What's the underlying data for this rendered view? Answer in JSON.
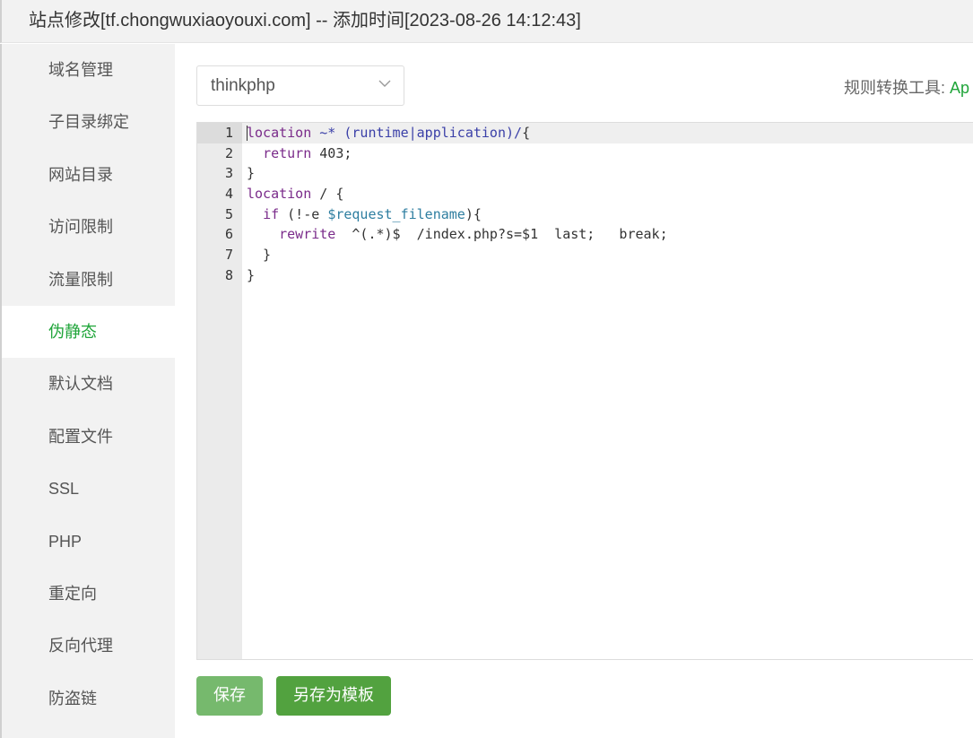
{
  "window": {
    "title": "站点修改[tf.chongwuxiaoyouxi.com] -- 添加时间[2023-08-26 14:12:43]"
  },
  "sidebar": {
    "items": [
      {
        "label": "域名管理"
      },
      {
        "label": "子目录绑定"
      },
      {
        "label": "网站目录"
      },
      {
        "label": "访问限制"
      },
      {
        "label": "流量限制"
      },
      {
        "label": "伪静态",
        "active": true
      },
      {
        "label": "默认文档"
      },
      {
        "label": "配置文件"
      },
      {
        "label": "SSL"
      },
      {
        "label": "PHP"
      },
      {
        "label": "重定向"
      },
      {
        "label": "反向代理"
      },
      {
        "label": "防盗链"
      }
    ]
  },
  "template_select": {
    "value": "thinkphp",
    "icon": "chevron-down-icon"
  },
  "rule_tool": {
    "label": "规则转换工具:",
    "link": "Ap"
  },
  "editor": {
    "line_numbers": [
      "1",
      "2",
      "3",
      "4",
      "5",
      "6",
      "7",
      "8"
    ],
    "lines": [
      "location ~* (runtime|application)/{",
      "  return 403;",
      "}",
      "location / {",
      "  if (!-e $request_filename){",
      "    rewrite  ^(.*)$  /index.php?s=$1  last;   break;",
      "  }",
      "}"
    ]
  },
  "buttons": {
    "save": "保存",
    "save_as_template": "另存为模板"
  },
  "colors": {
    "accent": "#20a53a",
    "save_button": "#76b96d",
    "template_button": "#52a23f",
    "sidebar_bg": "#f2f2f2",
    "gutter_bg": "#ebebeb"
  }
}
